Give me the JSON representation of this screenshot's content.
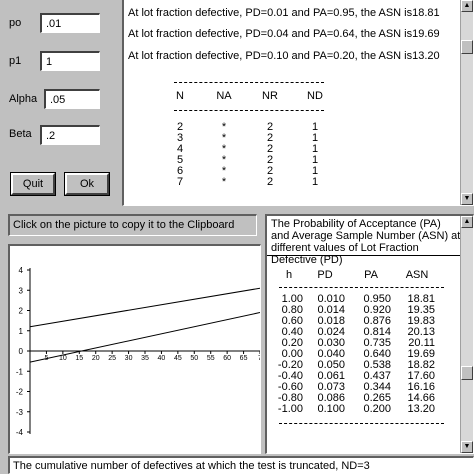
{
  "inputs": [
    {
      "label": "po",
      "value": ".01"
    },
    {
      "label": "p1",
      "value": "1"
    },
    {
      "label": "Alpha",
      "value": ".05"
    },
    {
      "label": "Beta",
      "value": ".2"
    }
  ],
  "buttons": {
    "quit": "Quit",
    "ok": "Ok"
  },
  "results": {
    "lines": [
      "At lot fraction defective, PD=0.01 and PA=0.95, the ASN is18.81",
      "At lot fraction defective, PD=0.04 and PA=0.64, the ASN is19.69",
      "At lot fraction defective, PD=0.10 and PA=0.20, the ASN is13.20"
    ],
    "columns": [
      "N",
      "NA",
      "NR",
      "ND"
    ],
    "rows": [
      [
        "2",
        "*",
        "2",
        "1"
      ],
      [
        "3",
        "*",
        "2",
        "1"
      ],
      [
        "4",
        "*",
        "2",
        "1"
      ],
      [
        "5",
        "*",
        "2",
        "1"
      ],
      [
        "6",
        "*",
        "2",
        "1"
      ],
      [
        "7",
        "*",
        "2",
        "1"
      ]
    ]
  },
  "clipboard_hint": "Click on the picture to copy it to the Clipboard",
  "chart_data": {
    "type": "line",
    "x_ticks": [
      "5",
      "10",
      "15",
      "20",
      "25",
      "30",
      "35",
      "40",
      "45",
      "50",
      "55",
      "60",
      "65",
      "7"
    ],
    "y_ticks": [
      "4",
      "3",
      "2",
      "1",
      "0",
      "-1",
      "-2",
      "-3",
      "-4"
    ],
    "xlim": [
      0,
      70
    ],
    "ylim": [
      -4,
      4
    ],
    "series": [
      {
        "x": [
          0,
          70
        ],
        "y": [
          1.2,
          3.1
        ]
      },
      {
        "x": [
          0,
          70
        ],
        "y": [
          -0.55,
          1.9
        ]
      }
    ]
  },
  "pa_table": {
    "title": "The Probability of Acceptance (PA) and Average Sample Number (ASN) at different values of Lot Fraction Defective (PD)",
    "headers": [
      "h",
      "PD",
      "PA",
      "ASN"
    ],
    "rows": [
      [
        "1.00",
        "0.010",
        "0.950",
        "18.81"
      ],
      [
        "0.80",
        "0.014",
        "0.920",
        "19.35"
      ],
      [
        "0.60",
        "0.018",
        "0.876",
        "19.83"
      ],
      [
        "0.40",
        "0.024",
        "0.814",
        "20.13"
      ],
      [
        "0.20",
        "0.030",
        "0.735",
        "20.11"
      ],
      [
        "0.00",
        "0.040",
        "0.640",
        "19.69"
      ],
      [
        "-0.20",
        "0.050",
        "0.538",
        "18.82"
      ],
      [
        "-0.40",
        "0.061",
        "0.437",
        "17.60"
      ],
      [
        "-0.60",
        "0.073",
        "0.344",
        "16.16"
      ],
      [
        "-0.80",
        "0.086",
        "0.265",
        "14.66"
      ],
      [
        "-1.00",
        "0.100",
        "0.200",
        "13.20"
      ]
    ]
  },
  "status": "The cumulative number of defectives at which the test is truncated, ND=3"
}
